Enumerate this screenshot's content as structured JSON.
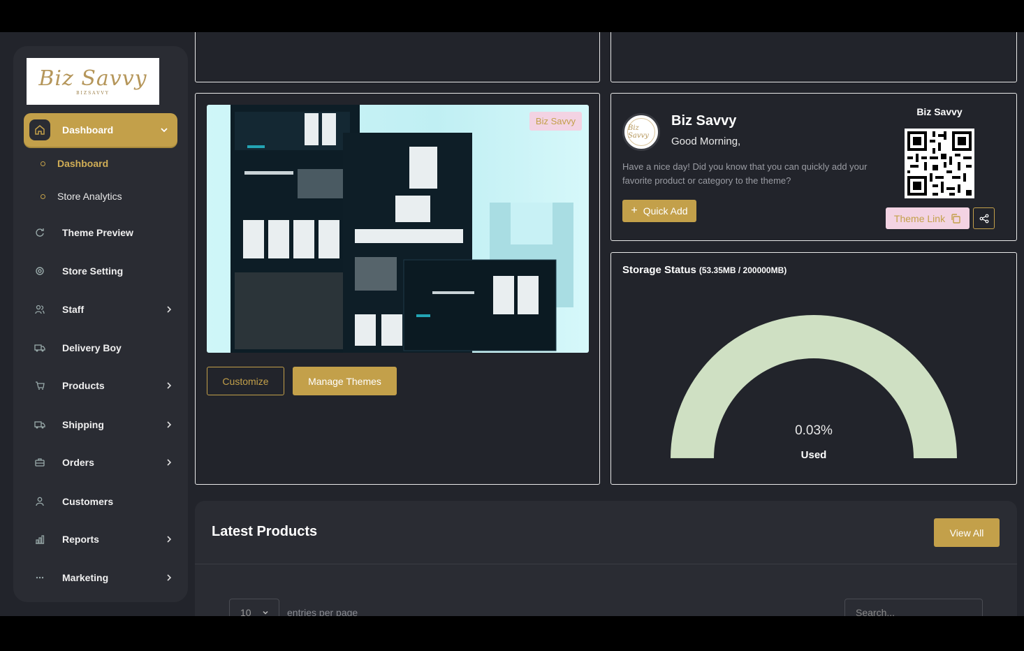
{
  "brand": {
    "logo_text": "Biz Savvy",
    "logo_sub": "BIZSAVVY"
  },
  "sidebar": {
    "active_item": {
      "label": "Dashboard",
      "icon": "home-icon"
    },
    "sub_items": [
      {
        "label": "Dashboard",
        "active": true
      },
      {
        "label": "Store Analytics",
        "active": false
      }
    ],
    "items": [
      {
        "label": "Theme Preview",
        "icon": "refresh-icon",
        "has_children": false
      },
      {
        "label": "Store Setting",
        "icon": "gear-icon",
        "has_children": false
      },
      {
        "label": "Staff",
        "icon": "users-icon",
        "has_children": true
      },
      {
        "label": "Delivery Boy",
        "icon": "truck-icon",
        "has_children": false
      },
      {
        "label": "Products",
        "icon": "cart-icon",
        "has_children": true
      },
      {
        "label": "Shipping",
        "icon": "shipping-truck-icon",
        "has_children": true
      },
      {
        "label": "Orders",
        "icon": "briefcase-icon",
        "has_children": true
      },
      {
        "label": "Customers",
        "icon": "user-icon",
        "has_children": false
      },
      {
        "label": "Reports",
        "icon": "bar-chart-icon",
        "has_children": true
      },
      {
        "label": "Marketing",
        "icon": "dots-icon",
        "has_children": true
      }
    ]
  },
  "theme_card": {
    "badge": "Biz Savvy",
    "customize_label": "Customize",
    "manage_label": "Manage Themes"
  },
  "store_card": {
    "store_name": "Biz Savvy",
    "greeting": "Good Morning,",
    "message": "Have a nice day! Did you know that you can quickly add your favorite product or category to the theme?",
    "quick_add_label": "Quick Add",
    "qr_title": "Biz Savvy",
    "theme_link_label": "Theme Link"
  },
  "storage": {
    "title": "Storage Status",
    "detail": "(53.35MB / 200000MB)",
    "percent_label": "0.03%",
    "used_label": "Used",
    "used_fraction": 0.0003,
    "color": "#cfe0c3"
  },
  "latest_products": {
    "title": "Latest Products",
    "view_all_label": "View All",
    "entries_value": "10",
    "entries_label": "entries per page",
    "search_placeholder": "Search..."
  },
  "colors": {
    "accent": "#c3a04a",
    "background": "#22242b",
    "panel": "#2a2c33"
  }
}
